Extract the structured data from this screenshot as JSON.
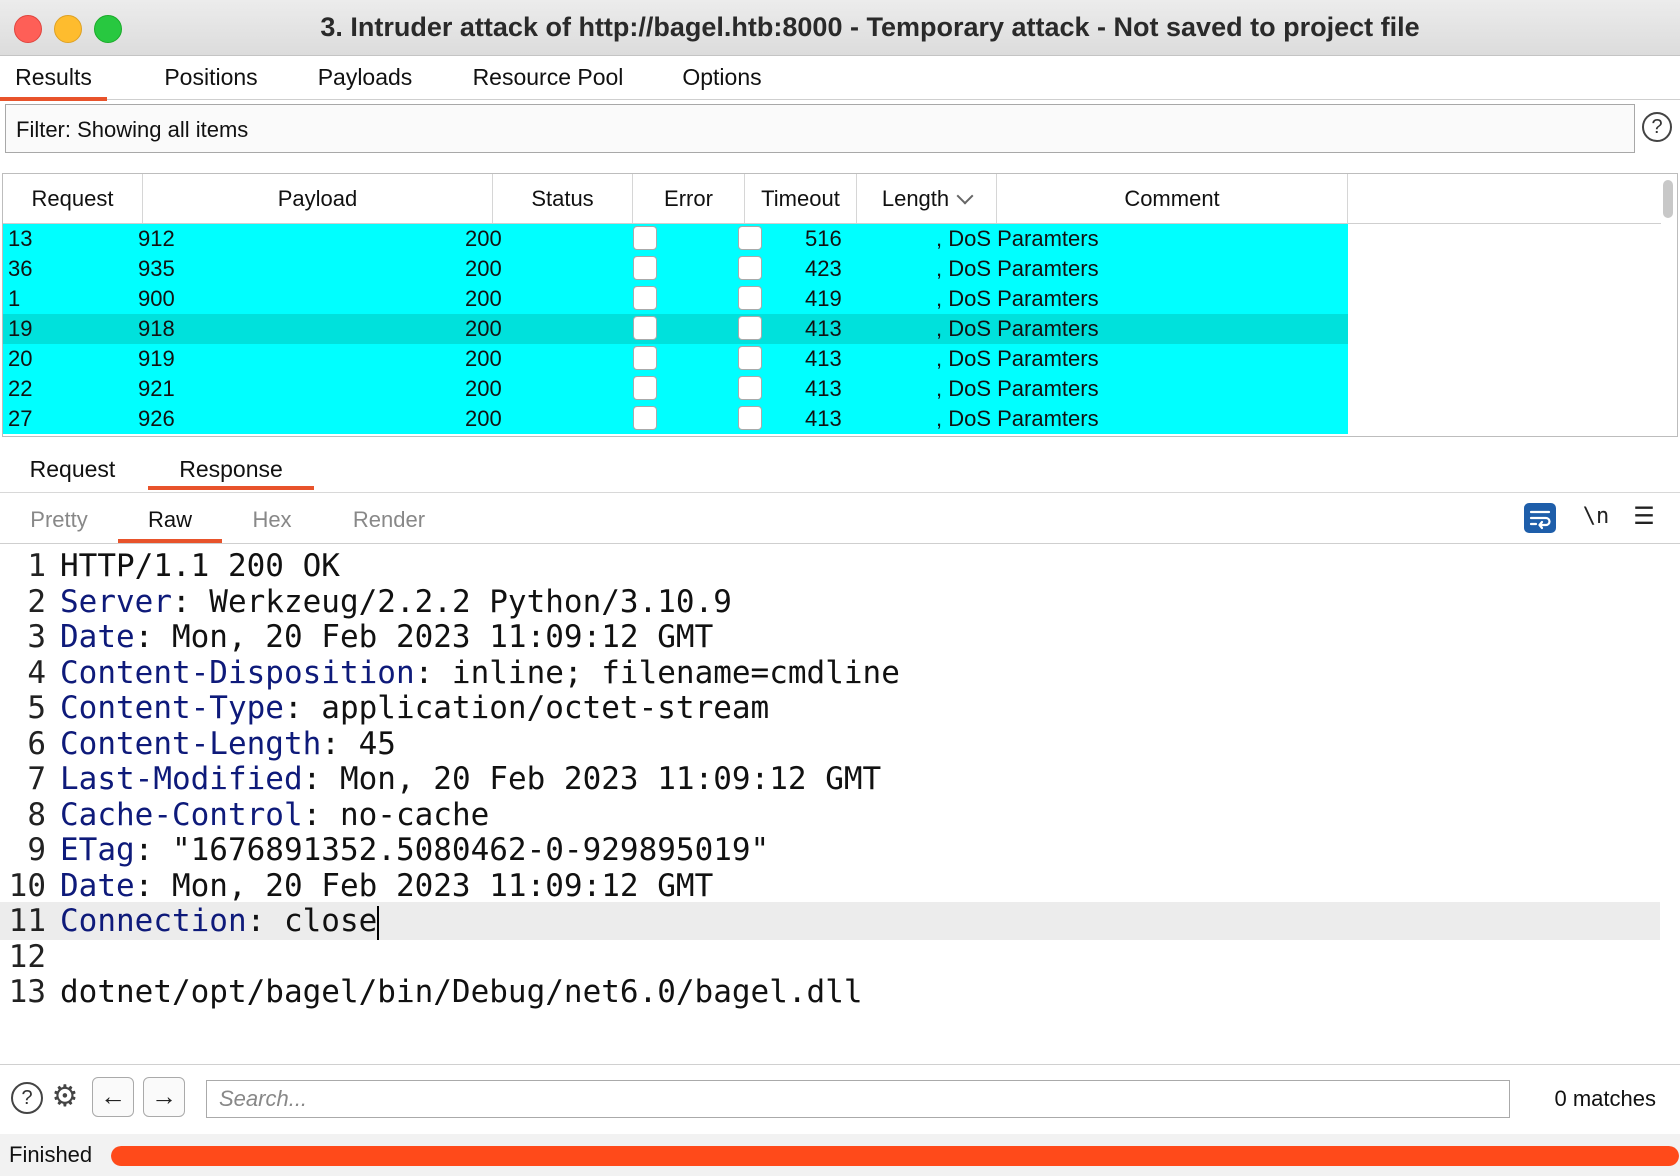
{
  "window": {
    "title": "3. Intruder attack of http://bagel.htb:8000 - Temporary attack - Not saved to project file"
  },
  "main_tabs": [
    {
      "label": "Results",
      "active": true
    },
    {
      "label": "Positions",
      "active": false
    },
    {
      "label": "Payloads",
      "active": false
    },
    {
      "label": "Resource Pool",
      "active": false
    },
    {
      "label": "Options",
      "active": false
    }
  ],
  "filter": {
    "text": "Filter: Showing all items",
    "help_icon": "question-circle-icon"
  },
  "results_table": {
    "columns": [
      "Request",
      "Payload",
      "Status",
      "Error",
      "Timeout",
      "Length",
      "Comment"
    ],
    "sort_column": "Length",
    "sort_icon": "chevron-down-icon",
    "row_color": "#00ffff",
    "selected_row_color": "#00e1dc",
    "rows": [
      {
        "request": "13",
        "payload": "912",
        "status": "200",
        "error": false,
        "timeout": false,
        "length": "516",
        "comment": ", DoS Paramters",
        "selected": false
      },
      {
        "request": "36",
        "payload": "935",
        "status": "200",
        "error": false,
        "timeout": false,
        "length": "423",
        "comment": ", DoS Paramters",
        "selected": false
      },
      {
        "request": "1",
        "payload": "900",
        "status": "200",
        "error": false,
        "timeout": false,
        "length": "419",
        "comment": ", DoS Paramters",
        "selected": false
      },
      {
        "request": "19",
        "payload": "918",
        "status": "200",
        "error": false,
        "timeout": false,
        "length": "413",
        "comment": ", DoS Paramters",
        "selected": true
      },
      {
        "request": "20",
        "payload": "919",
        "status": "200",
        "error": false,
        "timeout": false,
        "length": "413",
        "comment": ", DoS Paramters",
        "selected": false
      },
      {
        "request": "22",
        "payload": "921",
        "status": "200",
        "error": false,
        "timeout": false,
        "length": "413",
        "comment": ", DoS Paramters",
        "selected": false
      },
      {
        "request": "27",
        "payload": "926",
        "status": "200",
        "error": false,
        "timeout": false,
        "length": "413",
        "comment": ", DoS Paramters",
        "selected": false
      }
    ]
  },
  "rr_tabs": [
    {
      "label": "Request",
      "active": false
    },
    {
      "label": "Response",
      "active": true
    }
  ],
  "view_tabs": [
    {
      "label": "Pretty",
      "active": false
    },
    {
      "label": "Raw",
      "active": true
    },
    {
      "label": "Hex",
      "active": false
    },
    {
      "label": "Render",
      "active": false
    }
  ],
  "editor_toolbar": {
    "wrap_icon": "word-wrap-icon",
    "newline_label": "\\n",
    "menu_icon": "hamburger-menu-icon",
    "accent": "#1e5eaa"
  },
  "response_lines": [
    {
      "n": "1",
      "key": "",
      "rest": "HTTP/1.1 200 OK"
    },
    {
      "n": "2",
      "key": "Server",
      "rest": ": Werkzeug/2.2.2 Python/3.10.9"
    },
    {
      "n": "3",
      "key": "Date",
      "rest": ": Mon, 20 Feb 2023 11:09:12 GMT"
    },
    {
      "n": "4",
      "key": "Content-Disposition",
      "rest": ": inline; filename=cmdline"
    },
    {
      "n": "5",
      "key": "Content-Type",
      "rest": ": application/octet-stream"
    },
    {
      "n": "6",
      "key": "Content-Length",
      "rest": ": 45"
    },
    {
      "n": "7",
      "key": "Last-Modified",
      "rest": ": Mon, 20 Feb 2023 11:09:12 GMT"
    },
    {
      "n": "8",
      "key": "Cache-Control",
      "rest": ": no-cache"
    },
    {
      "n": "9",
      "key": "ETag",
      "rest": ": \"1676891352.5080462-0-929895019\""
    },
    {
      "n": "10",
      "key": "Date",
      "rest": ": Mon, 20 Feb 2023 11:09:12 GMT"
    },
    {
      "n": "11",
      "key": "Connection",
      "rest": ": close",
      "cursor": true
    },
    {
      "n": "12",
      "key": "",
      "rest": ""
    },
    {
      "n": "13",
      "key": "",
      "rest": "dotnet/opt/bagel/bin/Debug/net6.0/bagel.dll"
    }
  ],
  "search": {
    "placeholder": "Search...",
    "value": "",
    "matches": "0 matches",
    "help_icon": "question-circle-icon",
    "settings_icon": "gear-icon",
    "prev_icon": "arrow-left-icon",
    "next_icon": "arrow-right-icon"
  },
  "status": {
    "label": "Finished",
    "progress": 1.0,
    "color": "#ff4a1a"
  }
}
